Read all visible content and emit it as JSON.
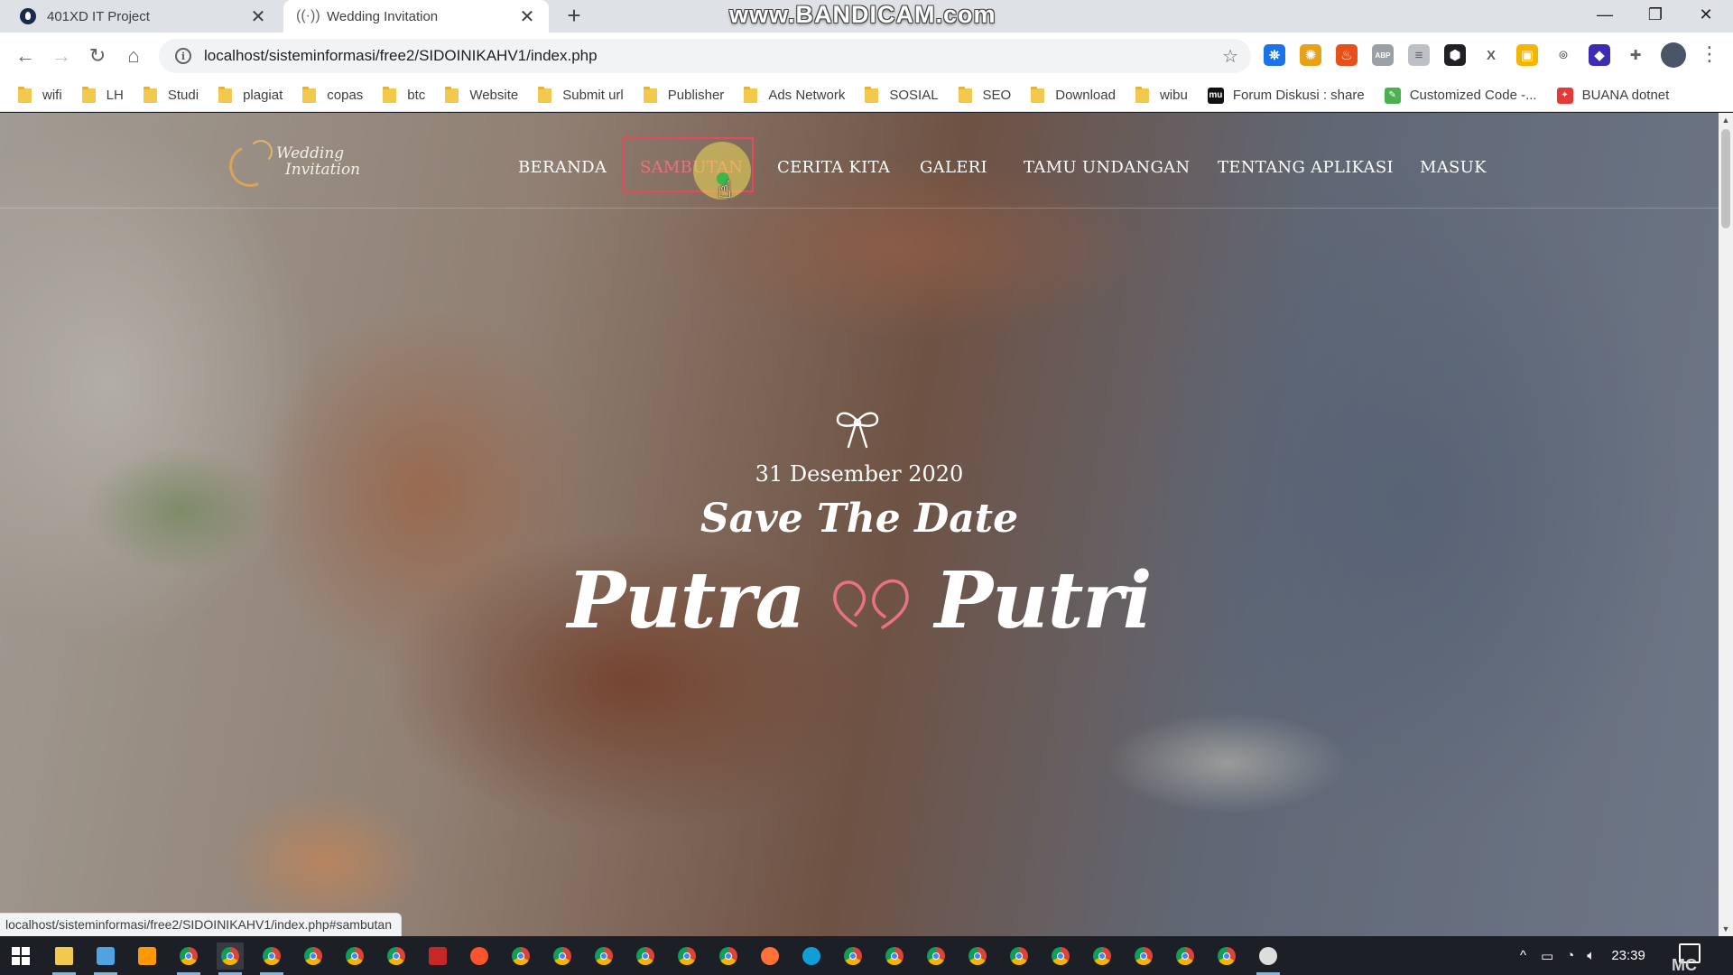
{
  "browser": {
    "tabs": [
      {
        "title": "401XD IT Project",
        "favicon": "dark-circle-icon",
        "active": false
      },
      {
        "title": "Wedding Invitation",
        "favicon": "loading-wave-icon",
        "active": true
      }
    ],
    "new_tab_label": "+",
    "close_glyph": "✕",
    "watermark": "www.BANDICAM.com",
    "address": {
      "url": "localhost/sisteminformasi/free2/SIDOINIKAHV1/index.php"
    },
    "bookmarks": [
      {
        "label": "wifi",
        "icon": "folder-icon"
      },
      {
        "label": "LH",
        "icon": "folder-icon"
      },
      {
        "label": "Studi",
        "icon": "folder-icon"
      },
      {
        "label": "plagiat",
        "icon": "folder-icon"
      },
      {
        "label": "copas",
        "icon": "folder-icon"
      },
      {
        "label": "btc",
        "icon": "folder-icon"
      },
      {
        "label": "Website",
        "icon": "folder-icon"
      },
      {
        "label": "Submit url",
        "icon": "folder-icon"
      },
      {
        "label": "Publisher",
        "icon": "folder-icon"
      },
      {
        "label": "Ads Network",
        "icon": "folder-icon"
      },
      {
        "label": "SOSIAL",
        "icon": "folder-icon"
      },
      {
        "label": "SEO",
        "icon": "folder-icon"
      },
      {
        "label": "Download",
        "icon": "folder-icon"
      },
      {
        "label": "wibu",
        "icon": "folder-icon"
      },
      {
        "label": "Forum Diskusi : share",
        "icon": "mu-site-icon"
      },
      {
        "label": "Customized Code -...",
        "icon": "code-site-icon"
      },
      {
        "label": "BUANA dotnet",
        "icon": "buana-site-icon"
      }
    ],
    "status_url": "localhost/sisteminformasi/free2/SIDOINIKAHV1/index.php#sambutan",
    "extensions": [
      {
        "name": "ext-person-icon",
        "color": "#1a73e8",
        "glyph": "⛯"
      },
      {
        "name": "ext-sun-icon",
        "color": "#e8a21a",
        "glyph": "✺"
      },
      {
        "name": "ext-fire-icon",
        "color": "#e8501a",
        "glyph": "♨"
      },
      {
        "name": "adblock-icon",
        "color": "#9aa0a6",
        "glyph": "ABP"
      },
      {
        "name": "ext-doc-icon",
        "color": "#bdc1c6",
        "glyph": "≡"
      },
      {
        "name": "ext-box-icon",
        "color": "#202124",
        "glyph": "⬢"
      },
      {
        "name": "ext-x-icon",
        "color": "#ffffff",
        "glyph": "X"
      },
      {
        "name": "ext-frame-icon",
        "color": "#f4b400",
        "glyph": "▣"
      },
      {
        "name": "camera-icon",
        "color": "#ffffff",
        "glyph": "⌾"
      },
      {
        "name": "ext-diamond-icon",
        "color": "#3c2bb5",
        "glyph": "◆"
      },
      {
        "name": "puzzle-icon",
        "color": "#ffffff",
        "glyph": "✚"
      }
    ]
  },
  "site": {
    "logo_line1": "Wedding",
    "logo_line2": "Invitation",
    "nav": [
      {
        "label": "BERANDA",
        "current": false
      },
      {
        "label": "SAMBUTAN",
        "current": true
      },
      {
        "label": "CERITA KITA",
        "current": false
      },
      {
        "label": "GALERI",
        "current": false
      },
      {
        "label": "TAMU UNDANGAN",
        "current": false
      },
      {
        "label": "TENTANG APLIKASI",
        "current": false
      },
      {
        "label": "MASUK",
        "current": false
      }
    ],
    "hero": {
      "date": "31 Desember 2020",
      "tagline": "Save The Date",
      "groom": "Putra",
      "bride": "Putri",
      "accent": "#e8737f"
    }
  },
  "taskbar": {
    "clock": "23:39",
    "watermark_corner": "MC"
  }
}
